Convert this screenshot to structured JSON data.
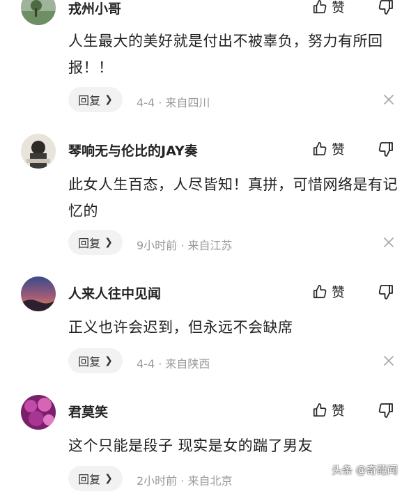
{
  "comments": [
    {
      "username": "戎州小哥",
      "like_label": "赞",
      "content": "人生最大的美好就是付出不被辜负，努力有所回报！！",
      "reply_label": "回复",
      "time": "4-4",
      "location": "来自四川",
      "separator": "·"
    },
    {
      "username": "琴响无与伦比的JAY奏",
      "like_label": "赞",
      "content": "此女人生百态，人尽皆知！真拼，可惜网络是有记忆的",
      "reply_label": "回复",
      "time": "9小时前",
      "location": "来自江苏",
      "separator": "·"
    },
    {
      "username": "人来人往中见闻",
      "like_label": "赞",
      "content": "正义也许会迟到，但永远不会缺席",
      "reply_label": "回复",
      "time": "4-4",
      "location": "来自陕西",
      "separator": "·"
    },
    {
      "username": "君莫笑",
      "like_label": "赞",
      "content": "这个只能是段子 现实是女的踹了男友",
      "reply_label": "回复",
      "time": "2小时前",
      "location": "来自北京",
      "separator": "·"
    }
  ],
  "watermark": "头条 @奇葩闻",
  "colors": {
    "text": "#222222",
    "meta": "#999999",
    "reply_bg": "#f2f2f2"
  },
  "icons": [
    "thumbs-up-icon",
    "thumbs-down-icon",
    "close-icon",
    "chevron-right-icon"
  ]
}
